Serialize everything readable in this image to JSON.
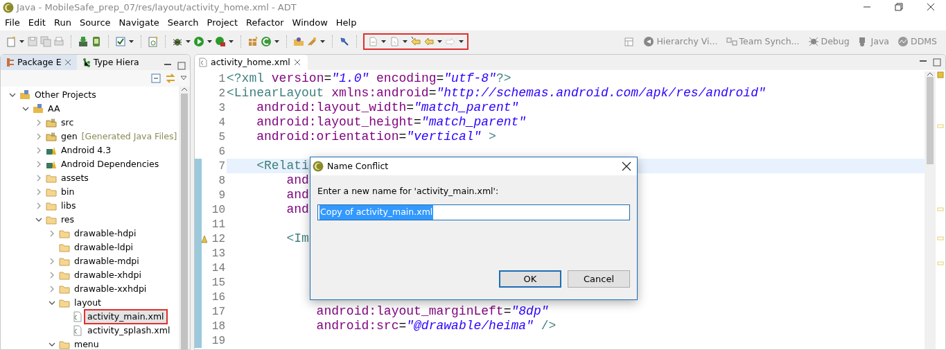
{
  "window": {
    "title": "Java - MobileSafe_prep_07/res/layout/activity_home.xml - ADT"
  },
  "menu_bar": [
    {
      "label": "File"
    },
    {
      "label": "Edit"
    },
    {
      "label": "Run"
    },
    {
      "label": "Source"
    },
    {
      "label": "Navigate"
    },
    {
      "label": "Search"
    },
    {
      "label": "Project"
    },
    {
      "label": "Refactor"
    },
    {
      "label": "Window"
    },
    {
      "label": "Help"
    }
  ],
  "toolbar": {
    "navigation_highlighted": true
  },
  "perspectives": [
    "Hierarchy Vi...",
    "Team Synch...",
    "Debug",
    "Java",
    "DDMS"
  ],
  "left_panel": {
    "tabs": [
      {
        "label": "Package E",
        "selected": true
      },
      {
        "label": "Type Hiera",
        "selected": false
      }
    ],
    "tree": [
      {
        "label": "Other Projects",
        "kind": "project",
        "expanded": true,
        "selected": false,
        "children": [
          {
            "label": "AA",
            "kind": "project",
            "expanded": true,
            "selected": false,
            "children": [
              {
                "label": "src",
                "kind": "source",
                "expanded": false,
                "selected": false
              },
              {
                "label": "gen",
                "note": "[Generated Java Files]",
                "kind": "source",
                "expanded": false,
                "selected": false
              },
              {
                "label": "Android 4.3",
                "kind": "library",
                "expanded": false,
                "selected": false
              },
              {
                "label": "Android Dependencies",
                "kind": "library",
                "expanded": false,
                "selected": false
              },
              {
                "label": "assets",
                "kind": "folder",
                "expanded": false,
                "selected": false
              },
              {
                "label": "bin",
                "kind": "folder",
                "expanded": false,
                "selected": false
              },
              {
                "label": "libs",
                "kind": "folder",
                "expanded": false,
                "selected": false
              },
              {
                "label": "res",
                "kind": "folder",
                "expanded": true,
                "selected": false,
                "children": [
                  {
                    "label": "drawable-hdpi",
                    "kind": "folder",
                    "expanded": false,
                    "selected": false
                  },
                  {
                    "label": "drawable-ldpi",
                    "kind": "folder",
                    "selected": false
                  },
                  {
                    "label": "drawable-mdpi",
                    "kind": "folder",
                    "expanded": false,
                    "selected": false
                  },
                  {
                    "label": "drawable-xhdpi",
                    "kind": "folder",
                    "expanded": false,
                    "selected": false
                  },
                  {
                    "label": "drawable-xxhdpi",
                    "kind": "folder",
                    "expanded": false,
                    "selected": false
                  },
                  {
                    "label": "layout",
                    "kind": "folder",
                    "expanded": true,
                    "selected": false,
                    "children": [
                      {
                        "label": "activity_main.xml",
                        "kind": "file",
                        "selected": true
                      },
                      {
                        "label": "activity_splash.xml",
                        "kind": "file",
                        "selected": false
                      }
                    ]
                  },
                  {
                    "label": "menu",
                    "kind": "folder",
                    "expanded": true,
                    "selected": false
                  }
                ]
              }
            ]
          }
        ]
      }
    ]
  },
  "editor": {
    "tabs": [
      {
        "label": "activity_home.xml",
        "selected": true
      }
    ],
    "lines": [
      {
        "number": "1",
        "tokens": [
          {
            "kind": "tag",
            "text": "<?xml"
          },
          {
            "kind": "attr",
            "text": " version"
          },
          {
            "kind": "plain",
            "text": "="
          },
          {
            "kind": "value",
            "text": "\"1.0\""
          },
          {
            "kind": "attr",
            "text": " encoding"
          },
          {
            "kind": "plain",
            "text": "="
          },
          {
            "kind": "value",
            "text": "\"utf-8\""
          },
          {
            "kind": "tag",
            "text": "?>"
          }
        ]
      },
      {
        "number": "2",
        "tokens": [
          {
            "kind": "tag",
            "text": "<LinearLayout"
          },
          {
            "kind": "attr",
            "text": " xmlns:android"
          },
          {
            "kind": "plain",
            "text": "="
          },
          {
            "kind": "value",
            "text": "\"http://schemas.android.com/apk/res/android\""
          }
        ]
      },
      {
        "number": "3",
        "tokens": [
          {
            "kind": "attr",
            "text": "    android:layout_width"
          },
          {
            "kind": "plain",
            "text": "="
          },
          {
            "kind": "value",
            "text": "\"match_parent\""
          }
        ]
      },
      {
        "number": "4",
        "tokens": [
          {
            "kind": "attr",
            "text": "    android:layout_height"
          },
          {
            "kind": "plain",
            "text": "="
          },
          {
            "kind": "value",
            "text": "\"match_parent\""
          }
        ]
      },
      {
        "number": "5",
        "tokens": [
          {
            "kind": "attr",
            "text": "    android:orientation"
          },
          {
            "kind": "plain",
            "text": "="
          },
          {
            "kind": "value",
            "text": "\"vertical\""
          },
          {
            "kind": "tag",
            "text": " >"
          }
        ]
      },
      {
        "number": "6"
      },
      {
        "number": "7",
        "current": true,
        "changed": true,
        "tokens": [
          {
            "kind": "tag",
            "text": "    <Relati"
          }
        ]
      },
      {
        "number": "8",
        "changed": true,
        "tokens": [
          {
            "kind": "attr",
            "text": "        and"
          }
        ]
      },
      {
        "number": "9",
        "changed": true,
        "tokens": [
          {
            "kind": "attr",
            "text": "        and"
          }
        ]
      },
      {
        "number": "10",
        "changed": true,
        "tokens": [
          {
            "kind": "attr",
            "text": "        and"
          }
        ]
      },
      {
        "number": "11",
        "changed": true
      },
      {
        "number": "12",
        "changed": true,
        "warning": true,
        "tokens": [
          {
            "kind": "tag",
            "text": "        <Im"
          }
        ]
      },
      {
        "number": "13",
        "changed": true
      },
      {
        "number": "14",
        "changed": true
      },
      {
        "number": "15",
        "changed": true
      },
      {
        "number": "16",
        "changed": true
      },
      {
        "number": "17",
        "changed": true,
        "tokens": [
          {
            "kind": "attr",
            "text": "            android:layout_marginLeft"
          },
          {
            "kind": "plain",
            "text": "="
          },
          {
            "kind": "value",
            "text": "\"8dp\""
          }
        ]
      },
      {
        "number": "18",
        "changed": true,
        "tokens": [
          {
            "kind": "attr",
            "text": "            android:src"
          },
          {
            "kind": "plain",
            "text": "="
          },
          {
            "kind": "value",
            "text": "\"@drawable/heima\""
          },
          {
            "kind": "tag",
            "text": " />"
          }
        ]
      },
      {
        "number": "19",
        "changed": true
      }
    ]
  },
  "dialog": {
    "title": "Name Conflict",
    "prompt": "Enter a new name for 'activity_main.xml':",
    "value": "Copy of activity_main.xml",
    "text_selected": true,
    "buttons": [
      {
        "label": "OK",
        "default": true
      },
      {
        "label": "Cancel",
        "default": false
      }
    ]
  }
}
